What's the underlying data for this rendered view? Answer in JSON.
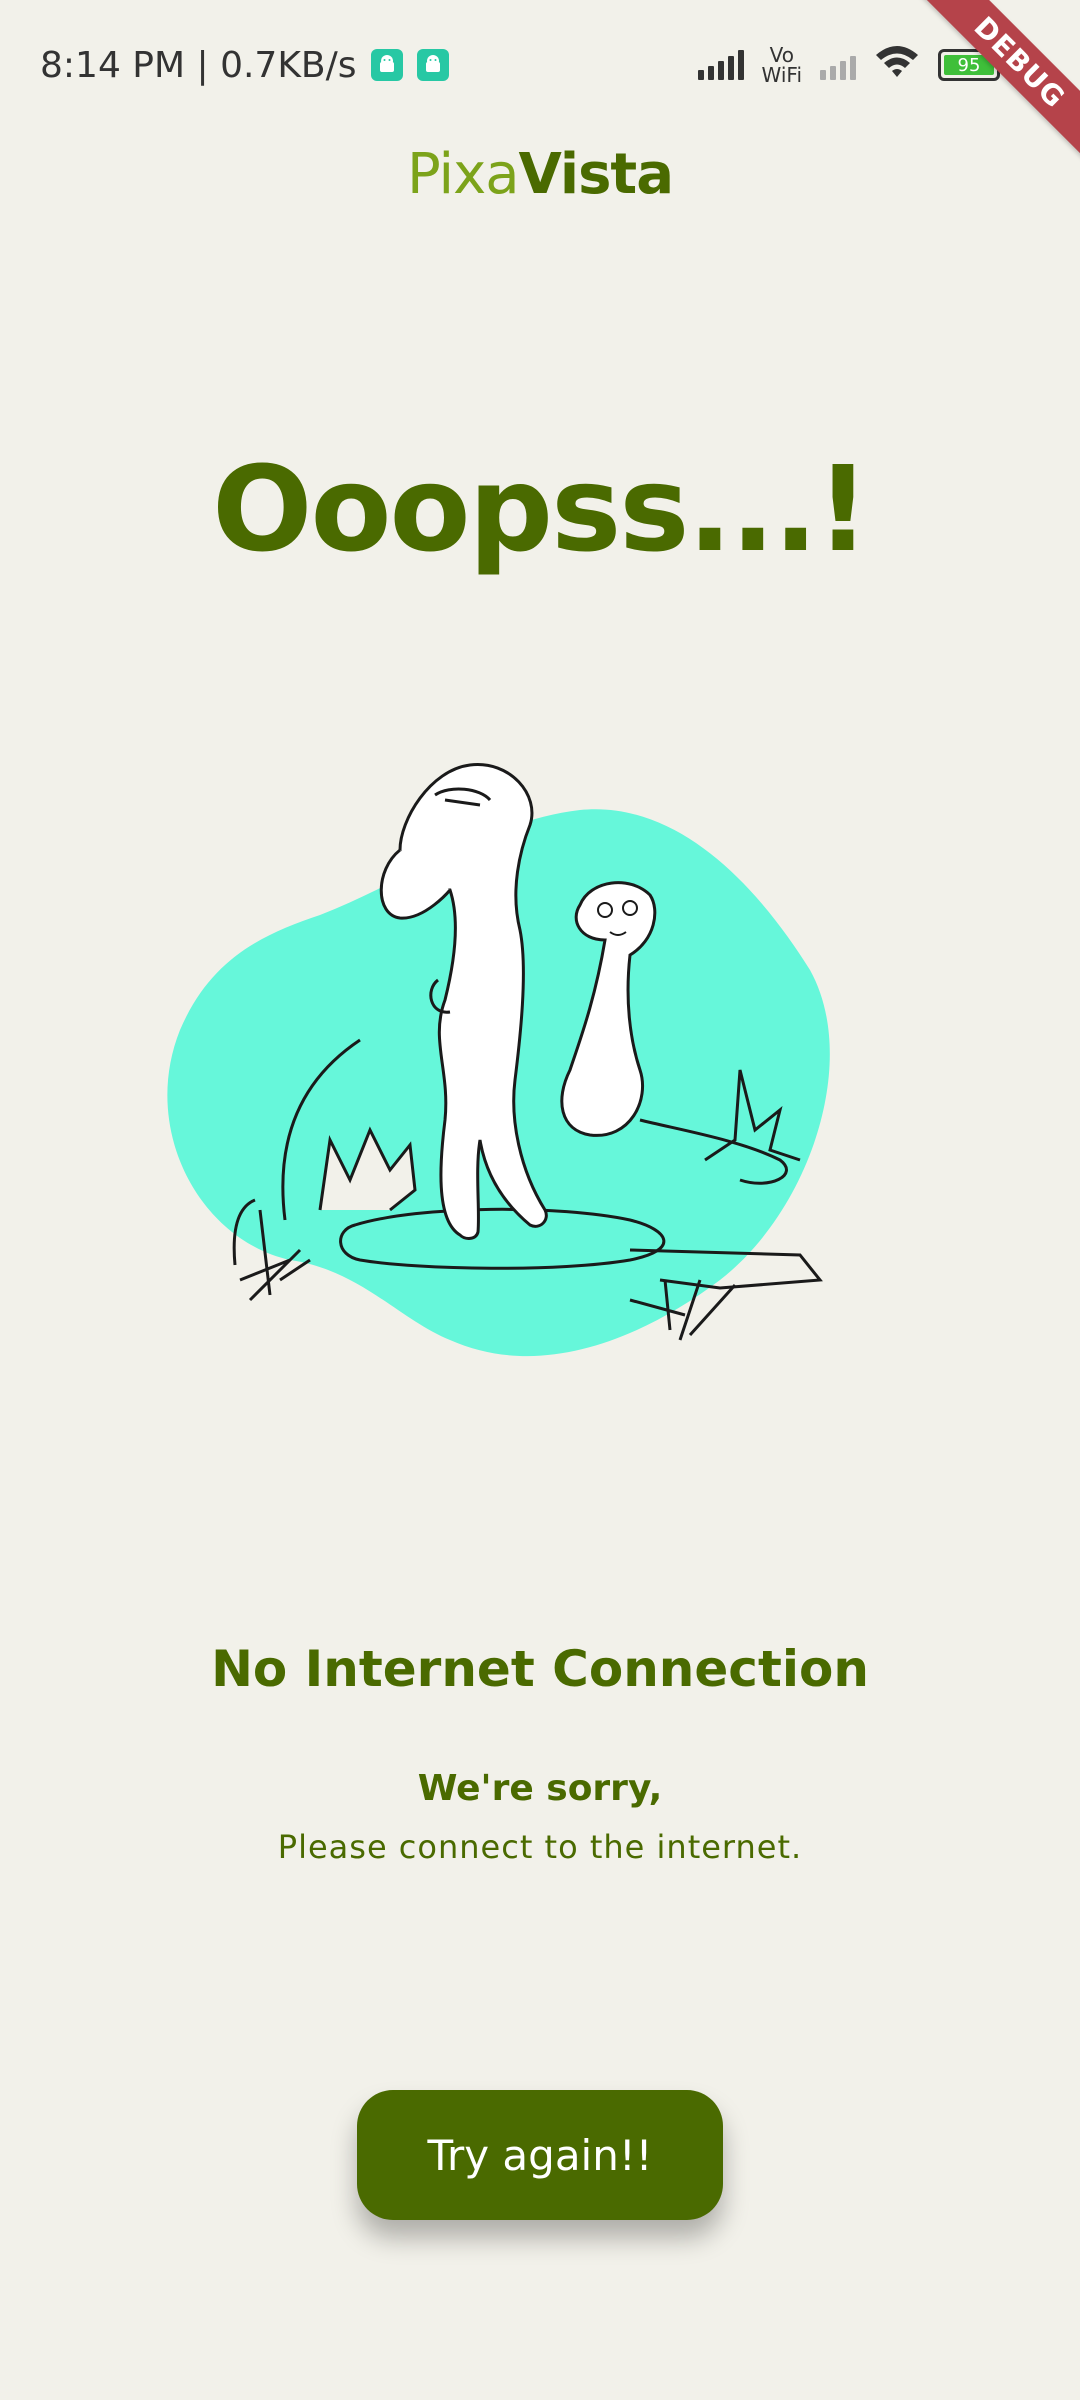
{
  "status_bar": {
    "time_speed": "8:14 PM | 0.7KB/s",
    "vowifi_top": "Vo",
    "vowifi_bottom": "WiFi",
    "battery": "95"
  },
  "debug_banner": "DEBUG",
  "brand": {
    "part1": "Pixa",
    "part2": "Vista"
  },
  "headline": "Ooopss...!",
  "message": {
    "title": "No Internet Connection",
    "sorry": "We're sorry,",
    "instruction": "Please connect to the internet."
  },
  "retry_button": "Try again!!",
  "colors": {
    "primary": "#4a6a00",
    "brand_light": "#7ca31a",
    "background": "#f2f1ea",
    "blob": "#66f7da",
    "debug": "#b5434a"
  }
}
